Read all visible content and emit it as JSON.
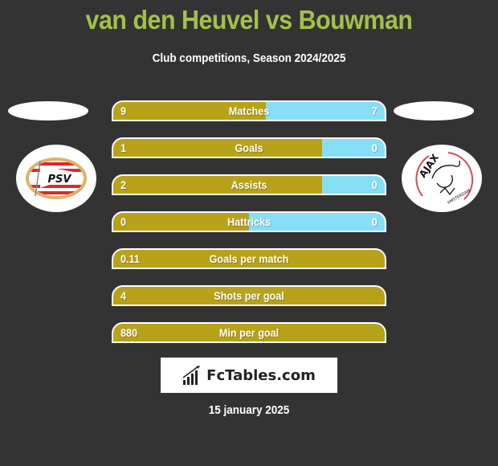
{
  "header": {
    "title": "van den Heuvel vs Bouwman",
    "subtitle": "Club competitions, Season 2024/2025"
  },
  "teams": {
    "left": {
      "name": "PSV",
      "logo_icon": "psv-logo-icon"
    },
    "right": {
      "name": "AJAX",
      "logo_icon": "ajax-logo-icon",
      "logo_subtext": "AMSTERDAM"
    }
  },
  "colors": {
    "title": "#a3c04a",
    "left_bar": "#b8a21a",
    "right_bar": "#87dff7",
    "background": "#333333"
  },
  "stats": [
    {
      "label": "Matches",
      "left": "9",
      "right": "7",
      "left_share": 0.5625
    },
    {
      "label": "Goals",
      "left": "1",
      "right": "0",
      "left_share": 0.77
    },
    {
      "label": "Assists",
      "left": "2",
      "right": "0",
      "left_share": 0.77
    },
    {
      "label": "Hattricks",
      "left": "0",
      "right": "0",
      "left_share": 0.5
    },
    {
      "label": "Goals per match",
      "left": "0.11",
      "right": "",
      "left_share": 1.0
    },
    {
      "label": "Shots per goal",
      "left": "4",
      "right": "",
      "left_share": 1.0
    },
    {
      "label": "Min per goal",
      "left": "880",
      "right": "",
      "left_share": 1.0
    }
  ],
  "footer": {
    "brand": "FcTables.com",
    "brand_icon": "bar-chart-icon",
    "date": "15 january 2025"
  }
}
